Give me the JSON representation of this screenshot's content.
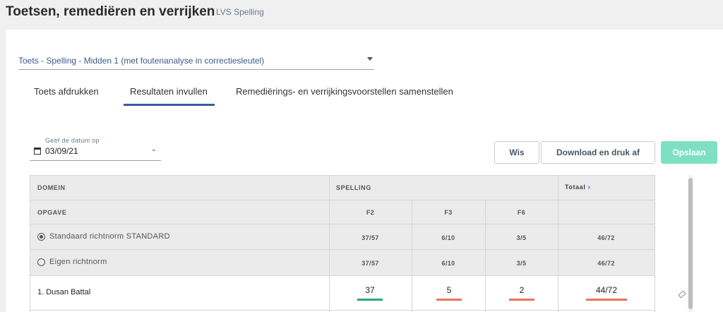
{
  "header": {
    "title": "Toetsen, remediëren en verrijken",
    "subtitle": "LVS Spelling"
  },
  "test_select": {
    "value": "Toets - Spelling - Midden 1 (met foutenanalyse in correctiesleutel)"
  },
  "tabs": [
    {
      "label": "Toets afdrukken",
      "active": false
    },
    {
      "label": "Resultaten invullen",
      "active": true
    },
    {
      "label": "Remediërings- en verrijkingsvoorstellen samenstellen",
      "active": false
    }
  ],
  "date": {
    "label": "Geef de datum op",
    "value": "03/09/21"
  },
  "buttons": {
    "clear": "Wis",
    "download": "Download en druk af",
    "save": "Opslaan"
  },
  "table": {
    "domain_header": "DOMEIN",
    "spelling_header": "SPELLING",
    "total_header": "Totaal",
    "task_header": "OPGAVE",
    "columns": [
      "F2",
      "F3",
      "F6"
    ],
    "norms": [
      {
        "label": "Standaard richtnorm STANDARD",
        "checked": true,
        "values": [
          "37/57",
          "6/10",
          "3/5"
        ],
        "total": "46/72"
      },
      {
        "label": "Eigen richtnorm",
        "checked": false,
        "values": [
          "37/57",
          "6/10",
          "3/5"
        ],
        "total": "46/72"
      }
    ],
    "students": [
      {
        "name": "1. Dusan Battal",
        "scores": [
          "37",
          "5",
          "2"
        ],
        "total": "44/72"
      }
    ]
  },
  "colors": {
    "accent": "#3e5b9b",
    "save_button": "#7ee0c3",
    "score_ok": "#2aa876",
    "score_low": "#e8745e"
  }
}
